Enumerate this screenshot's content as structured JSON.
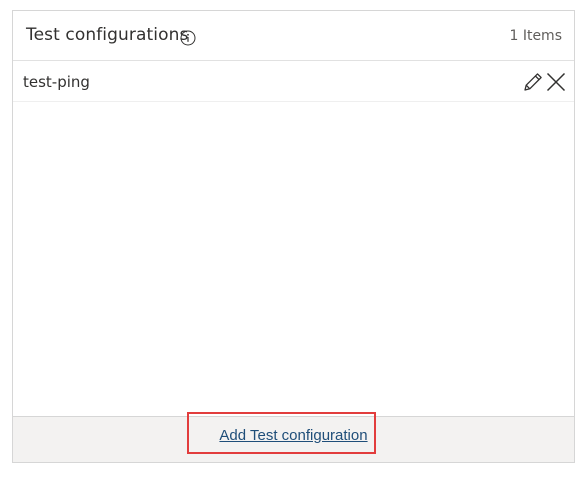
{
  "header": {
    "title": "Test configurations",
    "count": "1 Items",
    "info_icon": "info-icon"
  },
  "rows": [
    {
      "label": "test-ping",
      "actions": [
        "edit-icon",
        "delete-icon"
      ]
    }
  ],
  "footer": {
    "add_label": "Add Test configuration",
    "highlight_color": "#e23d3d",
    "link_color": "#1f4e79"
  }
}
